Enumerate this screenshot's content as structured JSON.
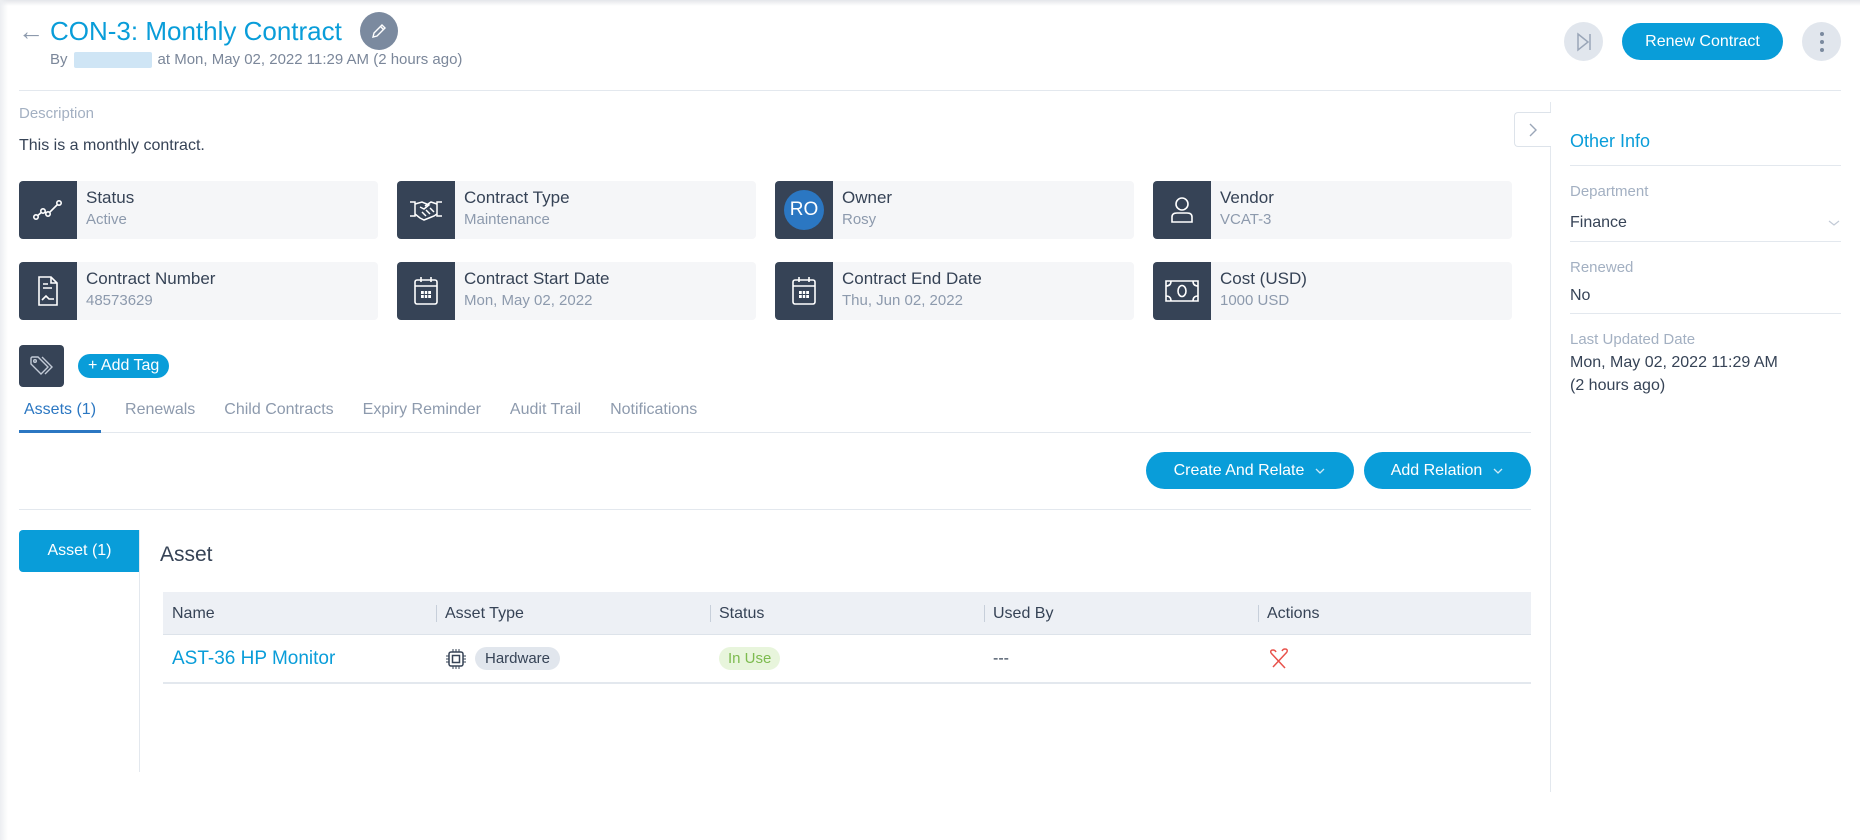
{
  "header": {
    "title": "CON-3: Monthly Contract",
    "by_prefix": "By",
    "created_at": "at Mon, May 02, 2022 11:29 AM (2 hours ago)",
    "renew_label": "Renew Contract"
  },
  "description": {
    "label": "Description",
    "text": "This is a monthly contract."
  },
  "cards": [
    {
      "label": "Status",
      "value": "Active",
      "icon": "trend-line-icon"
    },
    {
      "label": "Contract Type",
      "value": "Maintenance",
      "icon": "handshake-icon"
    },
    {
      "label": "Owner",
      "value": "Rosy",
      "icon": "avatar",
      "initials": "RO"
    },
    {
      "label": "Vendor",
      "value": "VCAT-3",
      "icon": "user-icon"
    },
    {
      "label": "Contract Number",
      "value": "48573629",
      "icon": "document-icon"
    },
    {
      "label": "Contract Start Date",
      "value": "Mon, May 02, 2022",
      "icon": "calendar-icon"
    },
    {
      "label": "Contract End Date",
      "value": "Thu, Jun 02, 2022",
      "icon": "calendar-icon"
    },
    {
      "label": "Cost (USD)",
      "value": "1000 USD",
      "icon": "money-icon"
    }
  ],
  "tags": {
    "add_label": "+ Add Tag"
  },
  "tabs": [
    {
      "label": "Assets (1)",
      "active": true
    },
    {
      "label": "Renewals"
    },
    {
      "label": "Child Contracts"
    },
    {
      "label": "Expiry Reminder"
    },
    {
      "label": "Audit Trail"
    },
    {
      "label": "Notifications"
    }
  ],
  "actions": {
    "create_and_relate": "Create And Relate",
    "add_relation": "Add Relation"
  },
  "assets": {
    "side_tab": "Asset (1)",
    "heading": "Asset",
    "columns": [
      "Name",
      "Asset Type",
      "Status",
      "Used By",
      "Actions"
    ],
    "rows": [
      {
        "name": "AST-36 HP Monitor",
        "asset_type": "Hardware",
        "status": "In Use",
        "used_by": "---"
      }
    ]
  },
  "other_info": {
    "title": "Other Info",
    "department_label": "Department",
    "department_value": "Finance",
    "renewed_label": "Renewed",
    "renewed_value": "No",
    "last_updated_label": "Last Updated Date",
    "last_updated_value": "Mon, May 02, 2022 11:29 AM",
    "last_updated_relative": "(2 hours ago)"
  },
  "colors": {
    "brand": "#099dd9",
    "dark": "#364356",
    "in_use_text": "#7dbb4f",
    "in_use_bg": "#e8f5dc",
    "unlink_red": "#e8514a"
  }
}
